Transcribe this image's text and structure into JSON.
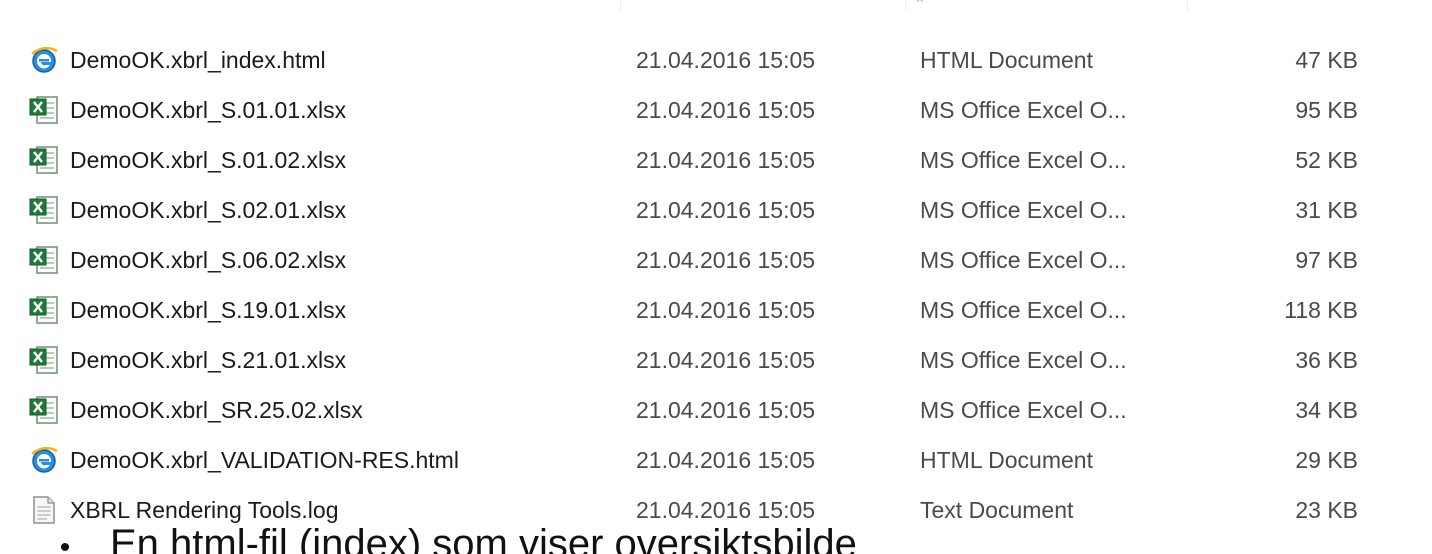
{
  "header": {
    "sort_indicator": "^"
  },
  "files": [
    {
      "name": "DemoOK.xbrl_index.html",
      "date": "21.04.2016 15:05",
      "type": "HTML Document",
      "size": "47 KB",
      "icon": "ie-html-icon"
    },
    {
      "name": "DemoOK.xbrl_S.01.01.xlsx",
      "date": "21.04.2016 15:05",
      "type": "MS Office Excel O...",
      "size": "95 KB",
      "icon": "excel-file-icon"
    },
    {
      "name": "DemoOK.xbrl_S.01.02.xlsx",
      "date": "21.04.2016 15:05",
      "type": "MS Office Excel O...",
      "size": "52 KB",
      "icon": "excel-file-icon"
    },
    {
      "name": "DemoOK.xbrl_S.02.01.xlsx",
      "date": "21.04.2016 15:05",
      "type": "MS Office Excel O...",
      "size": "31 KB",
      "icon": "excel-file-icon"
    },
    {
      "name": "DemoOK.xbrl_S.06.02.xlsx",
      "date": "21.04.2016 15:05",
      "type": "MS Office Excel O...",
      "size": "97 KB",
      "icon": "excel-file-icon"
    },
    {
      "name": "DemoOK.xbrl_S.19.01.xlsx",
      "date": "21.04.2016 15:05",
      "type": "MS Office Excel O...",
      "size": "118 KB",
      "icon": "excel-file-icon"
    },
    {
      "name": "DemoOK.xbrl_S.21.01.xlsx",
      "date": "21.04.2016 15:05",
      "type": "MS Office Excel O...",
      "size": "36 KB",
      "icon": "excel-file-icon"
    },
    {
      "name": "DemoOK.xbrl_SR.25.02.xlsx",
      "date": "21.04.2016 15:05",
      "type": "MS Office Excel O...",
      "size": "34 KB",
      "icon": "excel-file-icon"
    },
    {
      "name": "DemoOK.xbrl_VALIDATION-RES.html",
      "date": "21.04.2016 15:05",
      "type": "HTML Document",
      "size": "29 KB",
      "icon": "ie-html-icon"
    },
    {
      "name": "XBRL Rendering Tools.log",
      "date": "21.04.2016 15:05",
      "type": "Text Document",
      "size": "23 KB",
      "icon": "text-file-icon"
    }
  ],
  "caption": {
    "bullet": "•",
    "text": "En html-fil (index) som viser oversiktsbilde"
  },
  "colors": {
    "excel_green": "#1f7a3a",
    "ie_blue": "#1e73c8",
    "text": "#1b1b1b"
  }
}
